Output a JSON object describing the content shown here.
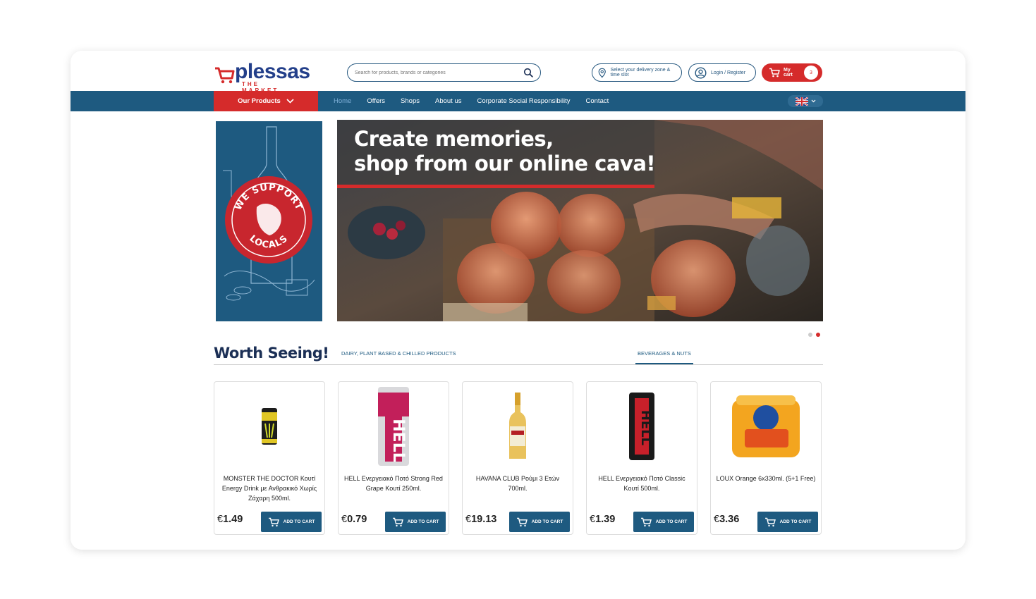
{
  "brand": {
    "name": "plessas",
    "tagline": "THE MARKET",
    "red": "#d52b2b",
    "blue": "#1e5a80"
  },
  "search": {
    "placeholder": "Search for products, brands or categories"
  },
  "header": {
    "delivery_label": "Select your delivery zone & time slot",
    "login_label": "Login / Register",
    "cart_label": "My cart",
    "cart_count": "3"
  },
  "nav": {
    "products_label": "Our Products",
    "links": [
      "Home",
      "Offers",
      "Shops",
      "About us",
      "Corporate Social Responsibility",
      "Contact"
    ],
    "language_icon": "uk-flag-icon"
  },
  "side_banner": {
    "badge_text": "WE SUPPORT LOCALS"
  },
  "hero": {
    "line1": "Create memories,",
    "line2": "shop from our online cava!",
    "slide_count": 2,
    "active_slide": 2
  },
  "section": {
    "title": "Worth Seeing!",
    "tabs": [
      "DAIRY, PLANT BASED & CHILLED PRODUCTS",
      "BEVERAGES & NUTS"
    ],
    "active_tab": 1
  },
  "products": [
    {
      "name": "MONSTER THE DOCTOR Κουτί Energy Drink με Ανθρακικό Χωρίς Ζάχαρη 500ml.",
      "currency": "€",
      "price": "1.49",
      "button": "ADD TO CART"
    },
    {
      "name": "HELL Ενεργειακό Ποτό Strong Red Grape Κουτί 250ml.",
      "currency": "€",
      "price": "0.79",
      "button": "ADD TO CART"
    },
    {
      "name": "HAVANA CLUB Ρούμι 3 Ετών 700ml.",
      "currency": "€",
      "price": "19.13",
      "button": "ADD TO CART"
    },
    {
      "name": "HELL Ενεργειακό Ποτό Classic Κουτί 500ml.",
      "currency": "€",
      "price": "1.39",
      "button": "ADD TO CART"
    },
    {
      "name": "LOUX Orange 6x330ml. (5+1 Free)",
      "currency": "€",
      "price": "3.36",
      "button": "ADD TO CART"
    }
  ]
}
